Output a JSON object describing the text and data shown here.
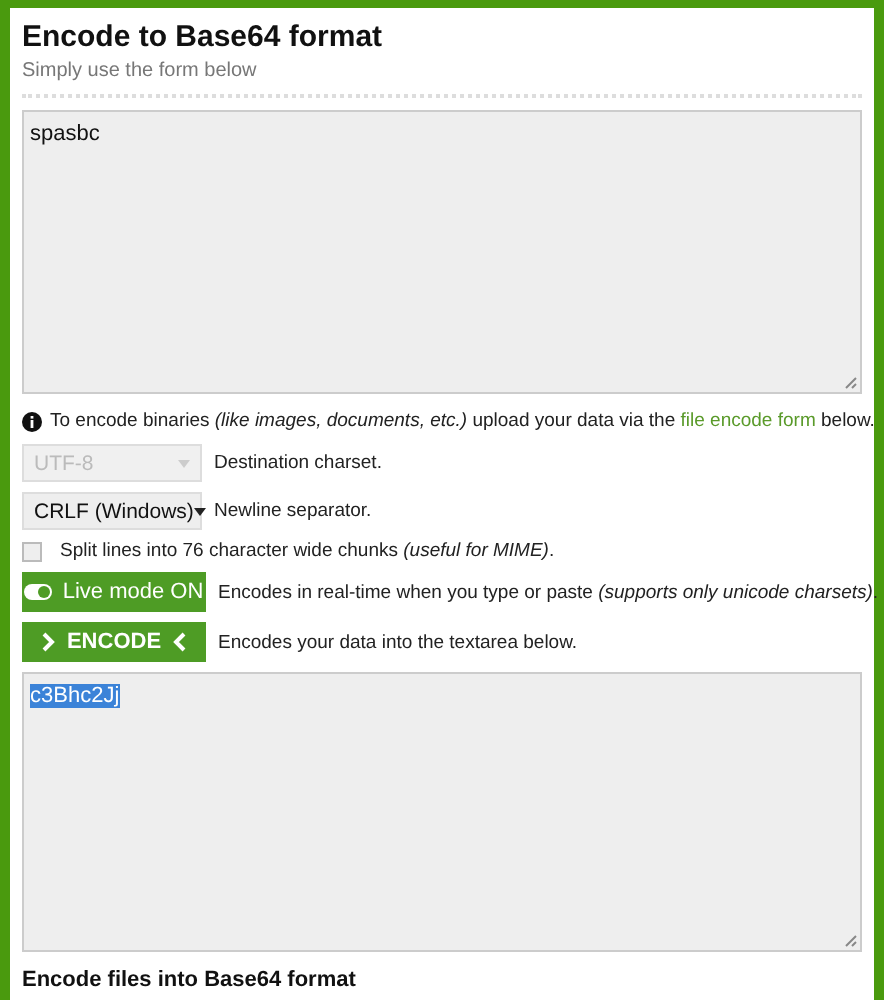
{
  "title": "Encode to Base64 format",
  "subtitle": "Simply use the form below",
  "input": {
    "value": "spasbc"
  },
  "info": {
    "before": "To encode binaries *(like images, documents, etc.)* upload your data via the ",
    "link": "file encode form",
    "after": " below."
  },
  "options": [
    {
      "kind": "select",
      "value": "UTF-8",
      "disabled": true,
      "label": "Destination charset."
    },
    {
      "kind": "select",
      "value": "CRLF (Windows)",
      "disabled": false,
      "label": "Newline separator."
    },
    {
      "kind": "checkbox",
      "checked": false,
      "label": "Split lines into 76 character wide chunks *(useful for MIME)*."
    },
    {
      "kind": "toggle",
      "on": true,
      "button": "Live mode ON",
      "label": "Encodes in real-time when you type or paste *(supports only unicode charsets)*."
    },
    {
      "kind": "action",
      "button": "ENCODE",
      "label": "Encodes your data into the textarea below."
    }
  ],
  "output": {
    "value": "c3Bhc2Jj",
    "selected": true
  },
  "section_heading": "Encode files into Base64 format"
}
